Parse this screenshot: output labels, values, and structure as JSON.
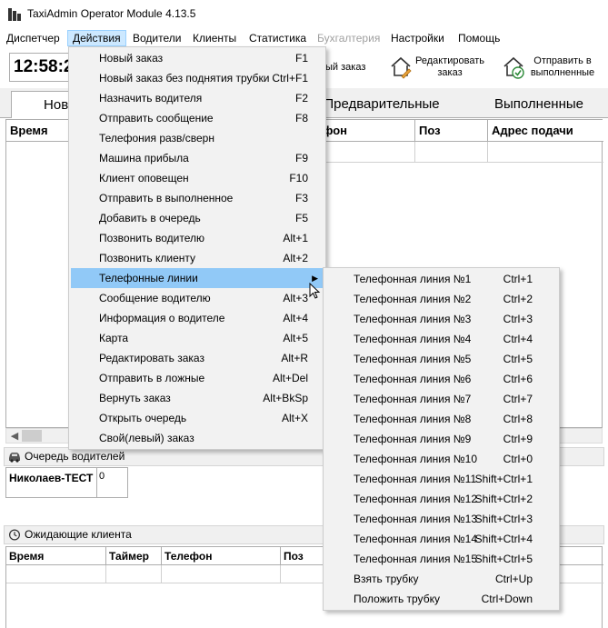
{
  "window": {
    "title": "TaxiAdmin Operator Module 4.13.5"
  },
  "menubar": [
    {
      "label": "Диспетчер",
      "state": "normal"
    },
    {
      "label": "Действия",
      "state": "active"
    },
    {
      "label": "Водители",
      "state": "normal"
    },
    {
      "label": "Клиенты",
      "state": "normal"
    },
    {
      "label": "Статистика",
      "state": "normal"
    },
    {
      "label": "Бухгалтерия",
      "state": "disabled"
    },
    {
      "label": "Настройки",
      "state": "normal"
    },
    {
      "label": "Помощь",
      "state": "normal"
    }
  ],
  "toolbar": {
    "clock": "12:58:2",
    "new_order_fragment": "ый заказ",
    "edit_order": "Редактировать заказ",
    "send_completed": "Отправить в выполненные"
  },
  "tabs": [
    {
      "label": "Новы",
      "selected": true
    },
    {
      "label": "Предварительные",
      "selected": false
    },
    {
      "label": "Выполненные",
      "selected": false
    }
  ],
  "orders_grid": {
    "columns": [
      "Время",
      "фон",
      "Поз",
      "Адрес подачи"
    ]
  },
  "drivers_queue": {
    "title": "Очередь водителей",
    "driver": "Николаев-ТЕСТ",
    "count": "0"
  },
  "waiting_clients": {
    "title": "Ожидающие клиента",
    "columns": [
      "Время",
      "Таймер",
      "Телефон",
      "Поз"
    ]
  },
  "actions_menu": [
    {
      "label": "Новый заказ",
      "shortcut": "F1"
    },
    {
      "label": "Новый заказ без поднятия трубки",
      "shortcut": "Ctrl+F1"
    },
    {
      "label": "Назначить водителя",
      "shortcut": "F2"
    },
    {
      "label": "Отправить сообщение",
      "shortcut": "F8"
    },
    {
      "label": "Телефония разв/сверн",
      "shortcut": ""
    },
    {
      "label": "Машина прибыла",
      "shortcut": "F9"
    },
    {
      "label": "Клиент оповещен",
      "shortcut": "F10"
    },
    {
      "label": "Отправить в выполненное",
      "shortcut": "F3"
    },
    {
      "label": "Добавить в очередь",
      "shortcut": "F5"
    },
    {
      "label": "Позвонить водителю",
      "shortcut": "Alt+1"
    },
    {
      "label": "Позвонить клиенту",
      "shortcut": "Alt+2"
    },
    {
      "label": "Телефонные линии",
      "shortcut": "",
      "submenu": true
    },
    {
      "label": "Сообщение водителю",
      "shortcut": "Alt+3"
    },
    {
      "label": "Информация о водителе",
      "shortcut": "Alt+4"
    },
    {
      "label": "Карта",
      "shortcut": "Alt+5"
    },
    {
      "label": "Редактировать заказ",
      "shortcut": "Alt+R"
    },
    {
      "label": "Отправить в ложные",
      "shortcut": "Alt+Del"
    },
    {
      "label": "Вернуть заказ",
      "shortcut": "Alt+BkSp"
    },
    {
      "label": "Открыть очередь",
      "shortcut": "Alt+X"
    },
    {
      "label": "Свой(левый) заказ",
      "shortcut": ""
    }
  ],
  "phone_lines_menu": [
    {
      "label": "Телефонная линия №1",
      "shortcut": "Ctrl+1"
    },
    {
      "label": "Телефонная линия №2",
      "shortcut": "Ctrl+2"
    },
    {
      "label": "Телефонная линия №3",
      "shortcut": "Ctrl+3"
    },
    {
      "label": "Телефонная линия №4",
      "shortcut": "Ctrl+4"
    },
    {
      "label": "Телефонная линия №5",
      "shortcut": "Ctrl+5"
    },
    {
      "label": "Телефонная линия №6",
      "shortcut": "Ctrl+6"
    },
    {
      "label": "Телефонная линия №7",
      "shortcut": "Ctrl+7"
    },
    {
      "label": "Телефонная линия №8",
      "shortcut": "Ctrl+8"
    },
    {
      "label": "Телефонная линия №9",
      "shortcut": "Ctrl+9"
    },
    {
      "label": "Телефонная линия №10",
      "shortcut": "Ctrl+0"
    },
    {
      "label": "Телефонная линия №11",
      "shortcut": "Shift+Ctrl+1"
    },
    {
      "label": "Телефонная линия №12",
      "shortcut": "Shift+Ctrl+2"
    },
    {
      "label": "Телефонная линия №13",
      "shortcut": "Shift+Ctrl+3"
    },
    {
      "label": "Телефонная линия №14",
      "shortcut": "Shift+Ctrl+4"
    },
    {
      "label": "Телефонная линия №15",
      "shortcut": "Shift+Ctrl+5"
    },
    {
      "label": "Взять трубку",
      "shortcut": "Ctrl+Up"
    },
    {
      "label": "Положить трубку",
      "shortcut": "Ctrl+Down"
    }
  ],
  "colors": {
    "menu_highlight": "#91c9f7",
    "menubar_active": "#cce8ff",
    "menu_background": "#f2f2f2",
    "disabled_text": "#a0a0a0"
  }
}
